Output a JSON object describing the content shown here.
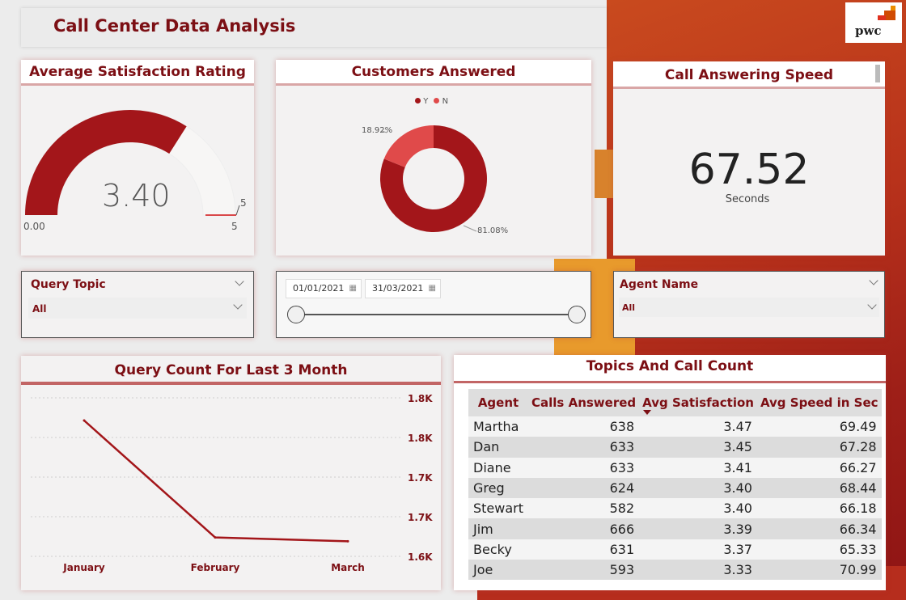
{
  "header": {
    "title": "Call Center Data Analysis",
    "logo_text": "pwc"
  },
  "satisfaction": {
    "title": "Average Satisfaction Rating",
    "value": "3.40",
    "min": "0.00",
    "max": "5",
    "target": "5",
    "fraction": 0.68
  },
  "answered": {
    "title": "Customers Answered",
    "legend": [
      {
        "label": "Y",
        "color": "#a3161a"
      },
      {
        "label": "N",
        "color": "#e04a4a"
      }
    ],
    "y_pct_label": "81.08%",
    "n_pct_label": "18.92%",
    "y_value": 81.08,
    "n_value": 18.92
  },
  "speed": {
    "title": "Call Answering Speed",
    "value": "67.52",
    "unit": "Seconds"
  },
  "query_slicer": {
    "label": "Query Topic",
    "value": "All"
  },
  "date_slicer": {
    "start": "01/01/2021",
    "end": "31/03/2021"
  },
  "agent_slicer": {
    "label": "Agent Name",
    "value": "All"
  },
  "line_chart": {
    "title": "Query Count For Last 3 Month"
  },
  "chart_data": {
    "type": "line",
    "title": "Query Count For Last 3 Month",
    "categories": [
      "January",
      "February",
      "March"
    ],
    "values": [
      1800,
      1645,
      1640
    ],
    "yticks": [
      "1.8K",
      "1.8K",
      "1.7K",
      "1.7K",
      "1.6K"
    ],
    "ylim": [
      1620,
      1830
    ]
  },
  "table": {
    "title": "Topics And Call Count",
    "columns": [
      "Agent",
      "Calls Answered",
      "Avg Satisfaction",
      "Avg Speed in Sec"
    ],
    "rows": [
      [
        "Martha",
        "638",
        "3.47",
        "69.49"
      ],
      [
        "Dan",
        "633",
        "3.45",
        "67.28"
      ],
      [
        "Diane",
        "633",
        "3.41",
        "66.27"
      ],
      [
        "Greg",
        "624",
        "3.40",
        "68.44"
      ],
      [
        "Stewart",
        "582",
        "3.40",
        "66.18"
      ],
      [
        "Jim",
        "666",
        "3.39",
        "66.34"
      ],
      [
        "Becky",
        "631",
        "3.37",
        "65.33"
      ],
      [
        "Joe",
        "593",
        "3.33",
        "70.99"
      ]
    ]
  }
}
